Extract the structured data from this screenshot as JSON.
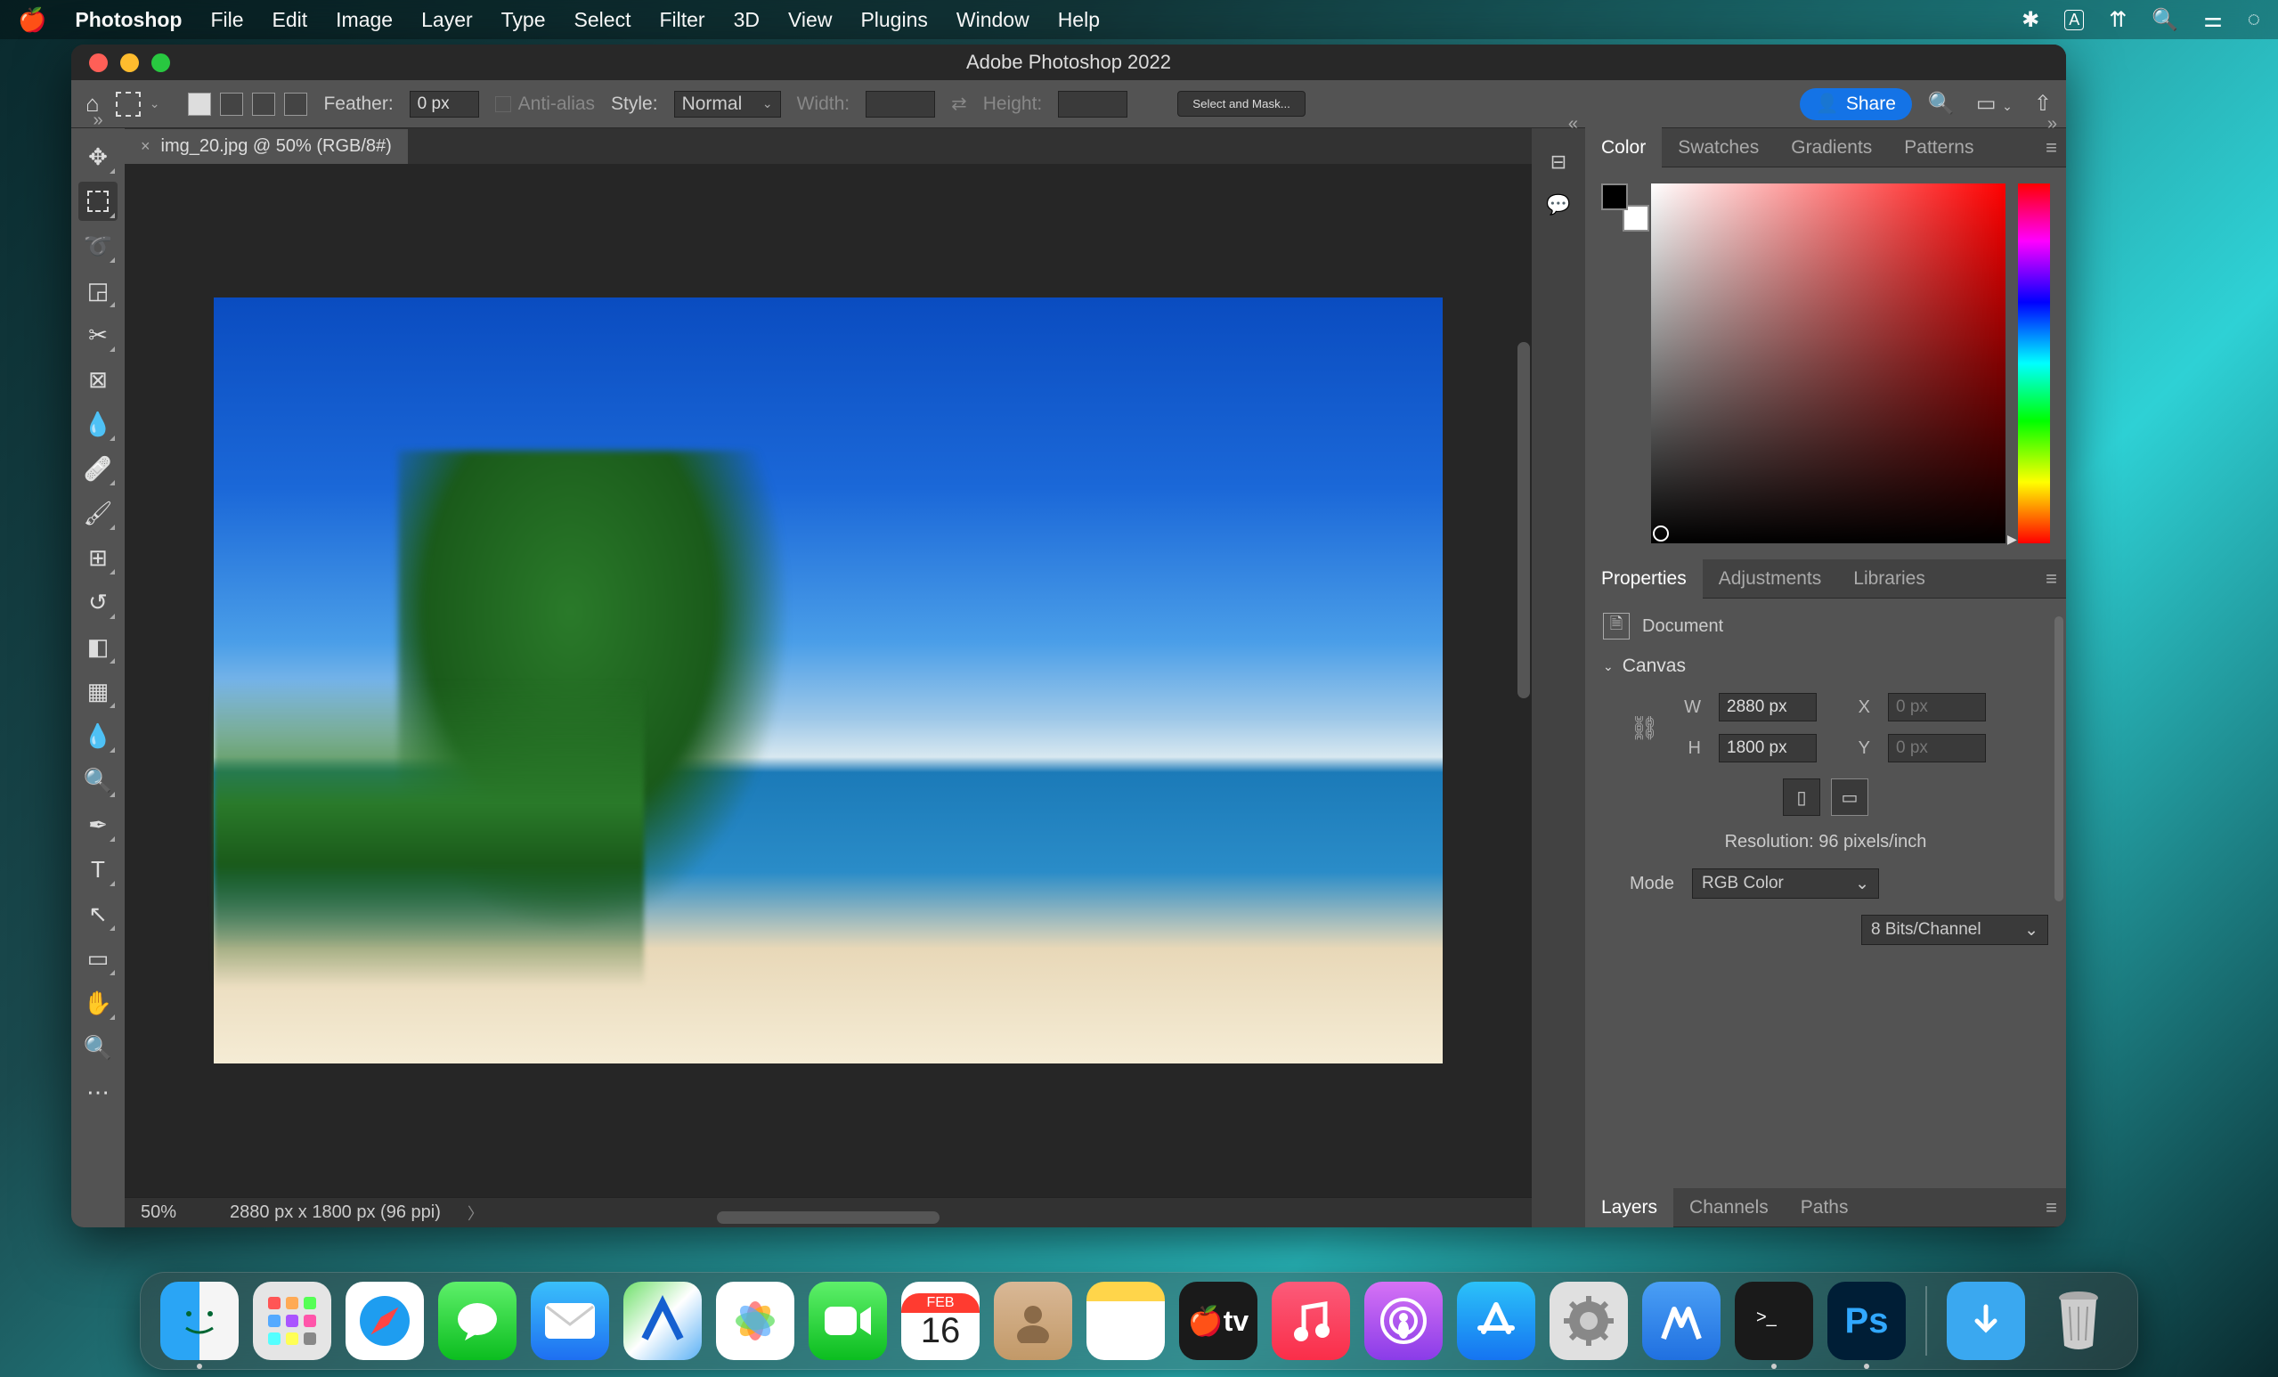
{
  "menubar": {
    "app": "Photoshop",
    "items": [
      "File",
      "Edit",
      "Image",
      "Layer",
      "Type",
      "Select",
      "Filter",
      "3D",
      "View",
      "Plugins",
      "Window",
      "Help"
    ]
  },
  "window": {
    "title": "Adobe Photoshop 2022"
  },
  "options_bar": {
    "feather_label": "Feather:",
    "feather_value": "0 px",
    "anti_alias": "Anti-alias",
    "style_label": "Style:",
    "style_value": "Normal",
    "width_label": "Width:",
    "height_label": "Height:",
    "select_mask": "Select and Mask...",
    "share": "Share"
  },
  "document": {
    "tab_title": "img_20.jpg @ 50% (RGB/8#)"
  },
  "status": {
    "zoom": "50%",
    "dims": "2880 px x 1800 px (96 ppi)"
  },
  "color_panel": {
    "tabs": [
      "Color",
      "Swatches",
      "Gradients",
      "Patterns"
    ],
    "active_tab": 0
  },
  "properties_panel": {
    "tabs": [
      "Properties",
      "Adjustments",
      "Libraries"
    ],
    "active_tab": 0,
    "type": "Document",
    "section": "Canvas",
    "w_label": "W",
    "w_value": "2880 px",
    "h_label": "H",
    "h_value": "1800 px",
    "x_label": "X",
    "x_value": "0 px",
    "y_label": "Y",
    "y_value": "0 px",
    "resolution": "Resolution: 96 pixels/inch",
    "mode_label": "Mode",
    "mode_value": "RGB Color",
    "bits_value": "8 Bits/Channel"
  },
  "layers_panel": {
    "tabs": [
      "Layers",
      "Channels",
      "Paths"
    ],
    "active_tab": 0
  },
  "dock": {
    "calendar_month": "FEB",
    "calendar_day": "16"
  }
}
